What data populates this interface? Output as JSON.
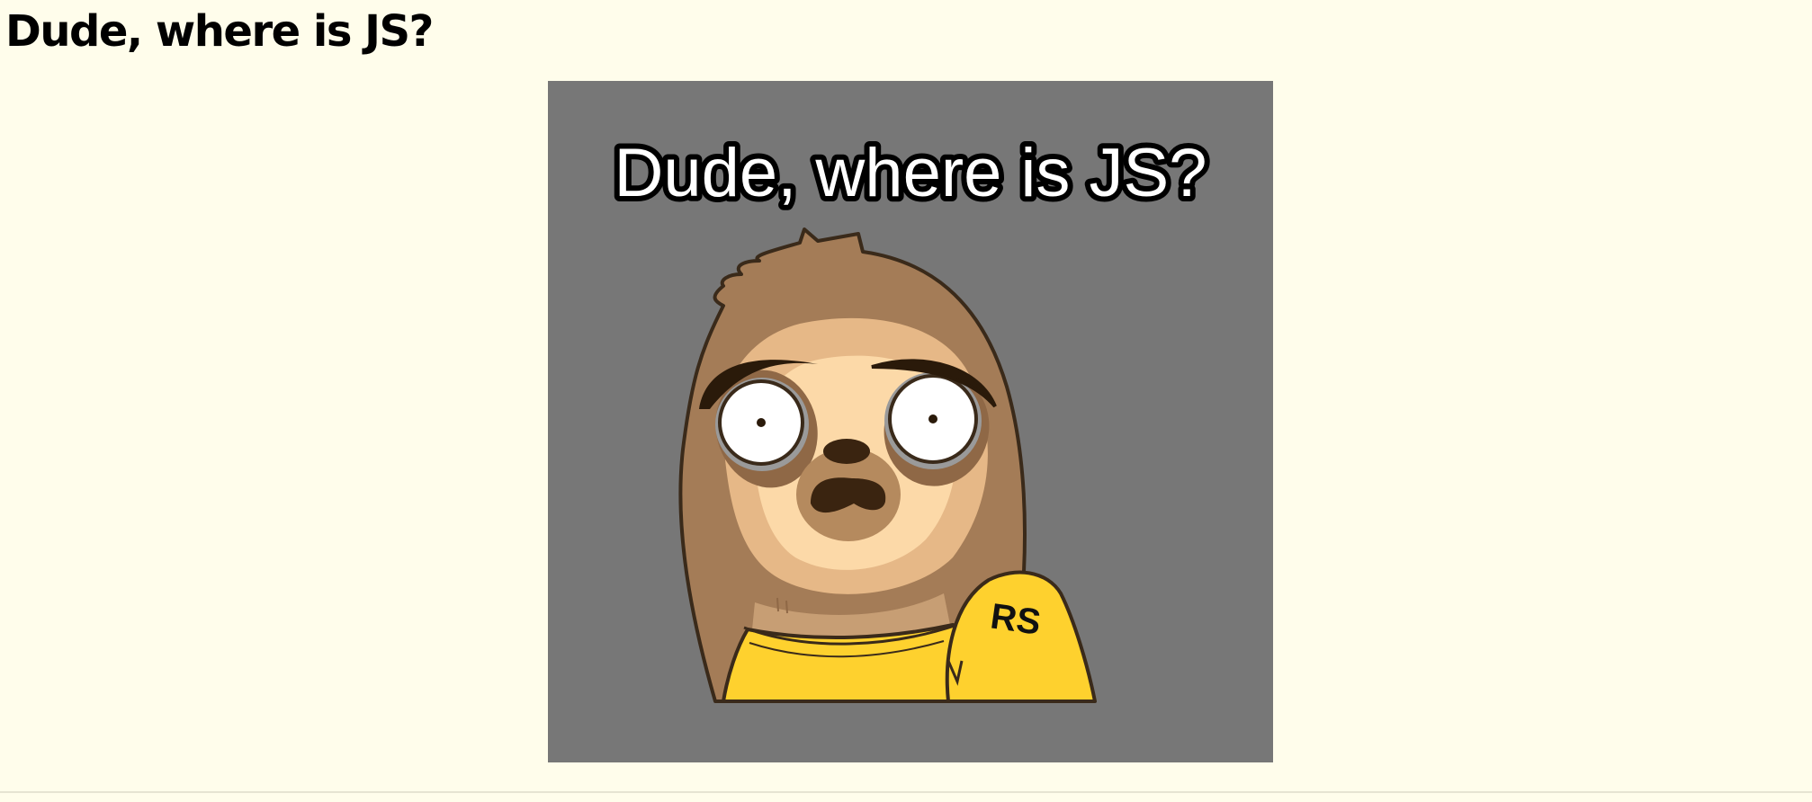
{
  "page": {
    "title": "Dude, where is JS?"
  },
  "meme": {
    "caption": "Dude, where is JS?",
    "badge_text": "RS",
    "alt": "Dude, where is JS?"
  },
  "colors": {
    "page_background": "#fffdeb",
    "meme_background": "#777777",
    "fur": "#a07a55",
    "face": "#fcd9a8",
    "shirt": "#fed12e",
    "outline": "#3a2a1a"
  },
  "icons": {
    "meme_character": "sloth"
  }
}
